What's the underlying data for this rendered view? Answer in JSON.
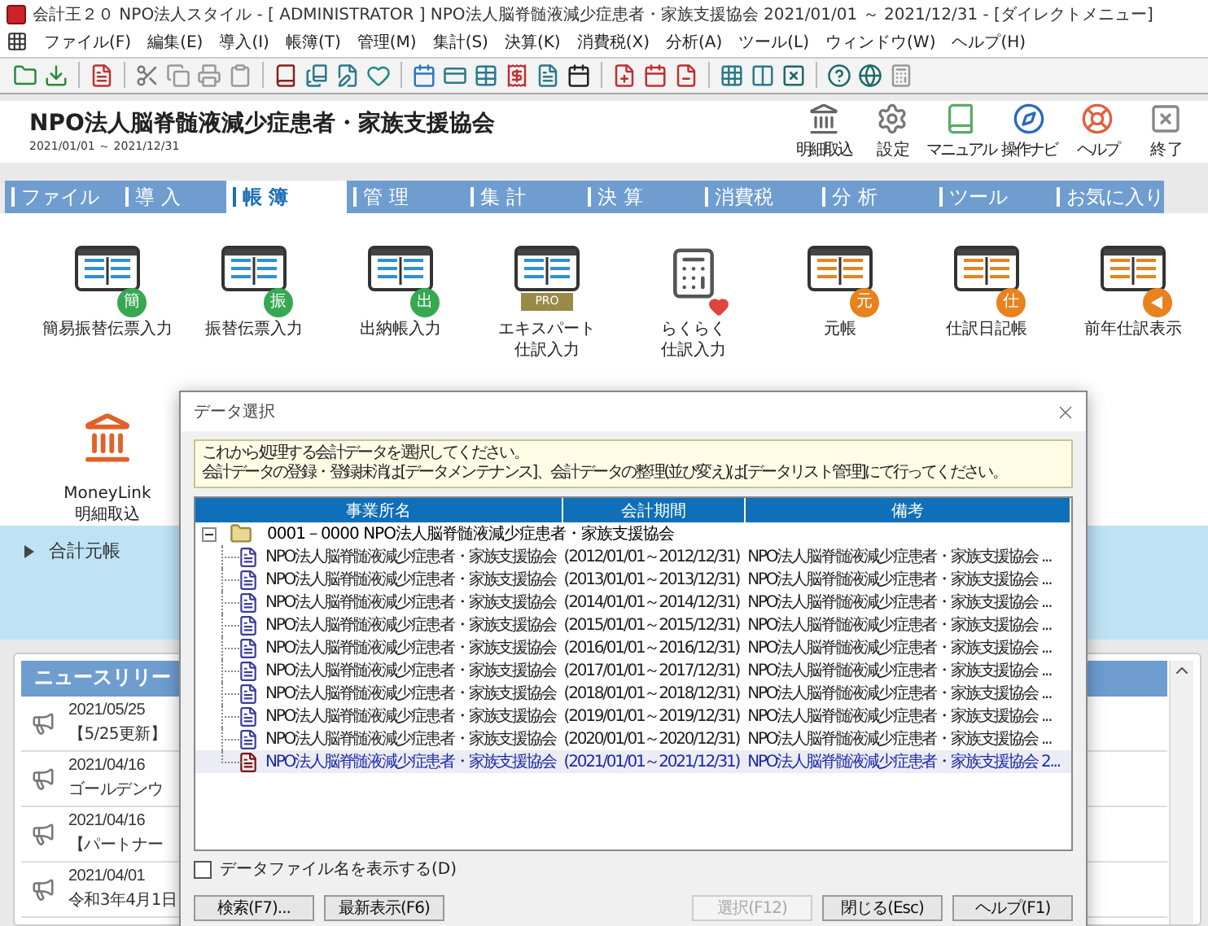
{
  "window": {
    "title": "会計王２０ NPO法人スタイル - [ ADMINISTRATOR ] NPO法人脳脊髄液減少症患者・家族支援協会 2021/01/01 ～ 2021/12/31 - [ダイレクトメニュー]"
  },
  "menu": [
    "ファイル(F)",
    "編集(E)",
    "導入(I)",
    "帳簿(T)",
    "管理(M)",
    "集計(S)",
    "決算(K)",
    "消費税(X)",
    "分析(A)",
    "ツール(L)",
    "ウィンドウ(W)",
    "ヘルプ(H)"
  ],
  "header": {
    "company": "NPO法人脳脊髄液減少症患者・家族支援協会",
    "period": "2021/01/01 ～ 2021/12/31",
    "actions": [
      {
        "kind": "bank",
        "label": "明細取込"
      },
      {
        "kind": "settings",
        "label": "設 定"
      },
      {
        "kind": "manual",
        "label": "マニュアル"
      },
      {
        "kind": "navi",
        "label": "操作ナビ"
      },
      {
        "kind": "help",
        "label": "ヘルプ"
      },
      {
        "kind": "exit",
        "label": "終 了"
      }
    ]
  },
  "tabs": [
    {
      "label": "ファイル",
      "selected": false
    },
    {
      "label": "導 入",
      "selected": false
    },
    {
      "label": "帳 簿",
      "selected": true
    },
    {
      "label": "管 理",
      "selected": false
    },
    {
      "label": "集 計",
      "selected": false
    },
    {
      "label": "決 算",
      "selected": false
    },
    {
      "label": "消費税",
      "selected": false
    },
    {
      "label": "分 析",
      "selected": false
    },
    {
      "label": "ツール",
      "selected": false
    },
    {
      "label": "お気に入り",
      "selected": false
    }
  ],
  "tools": [
    {
      "kind": "ledger",
      "color": "#2f8fd8",
      "label": [
        "簡易振替伝票入力"
      ],
      "badge": {
        "kind": "circle",
        "text": "簡",
        "color": "#36a852"
      }
    },
    {
      "kind": "ledger",
      "color": "#2f8fd8",
      "label": [
        "振替伝票入力"
      ],
      "badge": {
        "kind": "circle",
        "text": "振",
        "color": "#36a852"
      }
    },
    {
      "kind": "ledger",
      "color": "#2f8fd8",
      "label": [
        "出納帳入力"
      ],
      "badge": {
        "kind": "circle",
        "text": "出",
        "color": "#36a852"
      }
    },
    {
      "kind": "ledger",
      "color": "#2f8fd8",
      "label": [
        "エキスパート",
        "仕訳入力"
      ],
      "badge": {
        "kind": "pro",
        "text": "PRO",
        "color": "#9a8a4a"
      }
    },
    {
      "kind": "calculator",
      "color": "#555555",
      "label": [
        "らくらく",
        "仕訳入力"
      ],
      "badge": {
        "kind": "heart",
        "color": "#e0443e"
      }
    },
    {
      "kind": "ledger",
      "color": "#e8821e",
      "label": [
        "元帳"
      ],
      "badge": {
        "kind": "circle",
        "text": "元",
        "color": "#e8821e"
      }
    },
    {
      "kind": "ledger",
      "color": "#e8821e",
      "label": [
        "仕訳日記帳"
      ],
      "badge": {
        "kind": "circle",
        "text": "仕",
        "color": "#e8821e"
      }
    },
    {
      "kind": "ledger",
      "color": "#e8821e",
      "label": [
        "前年仕訳表示"
      ],
      "badge": {
        "kind": "play",
        "color": "#e8821e"
      }
    },
    {
      "kind": "bank",
      "color": "#e0622a",
      "label": [
        "MoneyLink",
        "明細取込"
      ]
    }
  ],
  "side_panel": {
    "items": [
      {
        "label": "合計元帳",
        "expanded": false
      }
    ]
  },
  "news": {
    "title": "ニュースリリー",
    "items": [
      {
        "date": "2021/05/25",
        "text": "【5/25更新】"
      },
      {
        "date": "2021/04/16",
        "text": "ゴールデンウ"
      },
      {
        "date": "2021/04/16",
        "text": "【パートナー"
      },
      {
        "date": "2021/04/01",
        "text": "令和3年4月1日"
      }
    ]
  },
  "dialog": {
    "title": "データ選択",
    "notice": [
      "これから処理する会計データを選択してください。",
      "会計データの登録・登録抹消は[データメンテナンス]、会計データの整理(並び変え)は[データリスト管理]にて行ってください。"
    ],
    "columns": [
      "事業所名",
      "会計期間",
      "備考"
    ],
    "root": {
      "label": "0001－0000 NPO法人脳脊髄液減少症患者・家族支援協会",
      "expanded": true,
      "children": [
        {
          "name": "NPO法人脳脊髄液減少症患者・家族支援協会",
          "period": "(2012/01/01～2012/12/31)",
          "note": "NPO法人脳脊髄液減少症患者・家族支援協会 ...",
          "selected": false
        },
        {
          "name": "NPO法人脳脊髄液減少症患者・家族支援協会",
          "period": "(2013/01/01～2013/12/31)",
          "note": "NPO法人脳脊髄液減少症患者・家族支援協会 ...",
          "selected": false
        },
        {
          "name": "NPO法人脳脊髄液減少症患者・家族支援協会",
          "period": "(2014/01/01～2014/12/31)",
          "note": "NPO法人脳脊髄液減少症患者・家族支援協会 ...",
          "selected": false
        },
        {
          "name": "NPO法人脳脊髄液減少症患者・家族支援協会",
          "period": "(2015/01/01～2015/12/31)",
          "note": "NPO法人脳脊髄液減少症患者・家族支援協会 ...",
          "selected": false
        },
        {
          "name": "NPO法人脳脊髄液減少症患者・家族支援協会",
          "period": "(2016/01/01～2016/12/31)",
          "note": "NPO法人脳脊髄液減少症患者・家族支援協会 ...",
          "selected": false
        },
        {
          "name": "NPO法人脳脊髄液減少症患者・家族支援協会",
          "period": "(2017/01/01～2017/12/31)",
          "note": "NPO法人脳脊髄液減少症患者・家族支援協会 ...",
          "selected": false
        },
        {
          "name": "NPO法人脳脊髄液減少症患者・家族支援協会",
          "period": "(2018/01/01～2018/12/31)",
          "note": "NPO法人脳脊髄液減少症患者・家族支援協会 ...",
          "selected": false
        },
        {
          "name": "NPO法人脳脊髄液減少症患者・家族支援協会",
          "period": "(2019/01/01～2019/12/31)",
          "note": "NPO法人脳脊髄液減少症患者・家族支援協会 ...",
          "selected": false
        },
        {
          "name": "NPO法人脳脊髄液減少症患者・家族支援協会",
          "period": "(2020/01/01～2020/12/31)",
          "note": "NPO法人脳脊髄液減少症患者・家族支援協会 ...",
          "selected": false
        },
        {
          "name": "NPO法人脳脊髄液減少症患者・家族支援協会",
          "period": "(2021/01/01～2021/12/31)",
          "note": "NPO法人脳脊髄液減少症患者・家族支援協会 2...",
          "selected": true
        }
      ]
    },
    "show_filename": {
      "label": "データファイル名を表示する(D)",
      "checked": false
    },
    "buttons": [
      {
        "label": "検索(F7)...",
        "disabled": false
      },
      {
        "label": "最新表示(F6)",
        "disabled": false
      },
      {
        "label": "選択(F12)",
        "disabled": true
      },
      {
        "label": "閉じる(Esc)",
        "disabled": false
      },
      {
        "label": "ヘルプ(F1)",
        "disabled": false
      }
    ]
  }
}
